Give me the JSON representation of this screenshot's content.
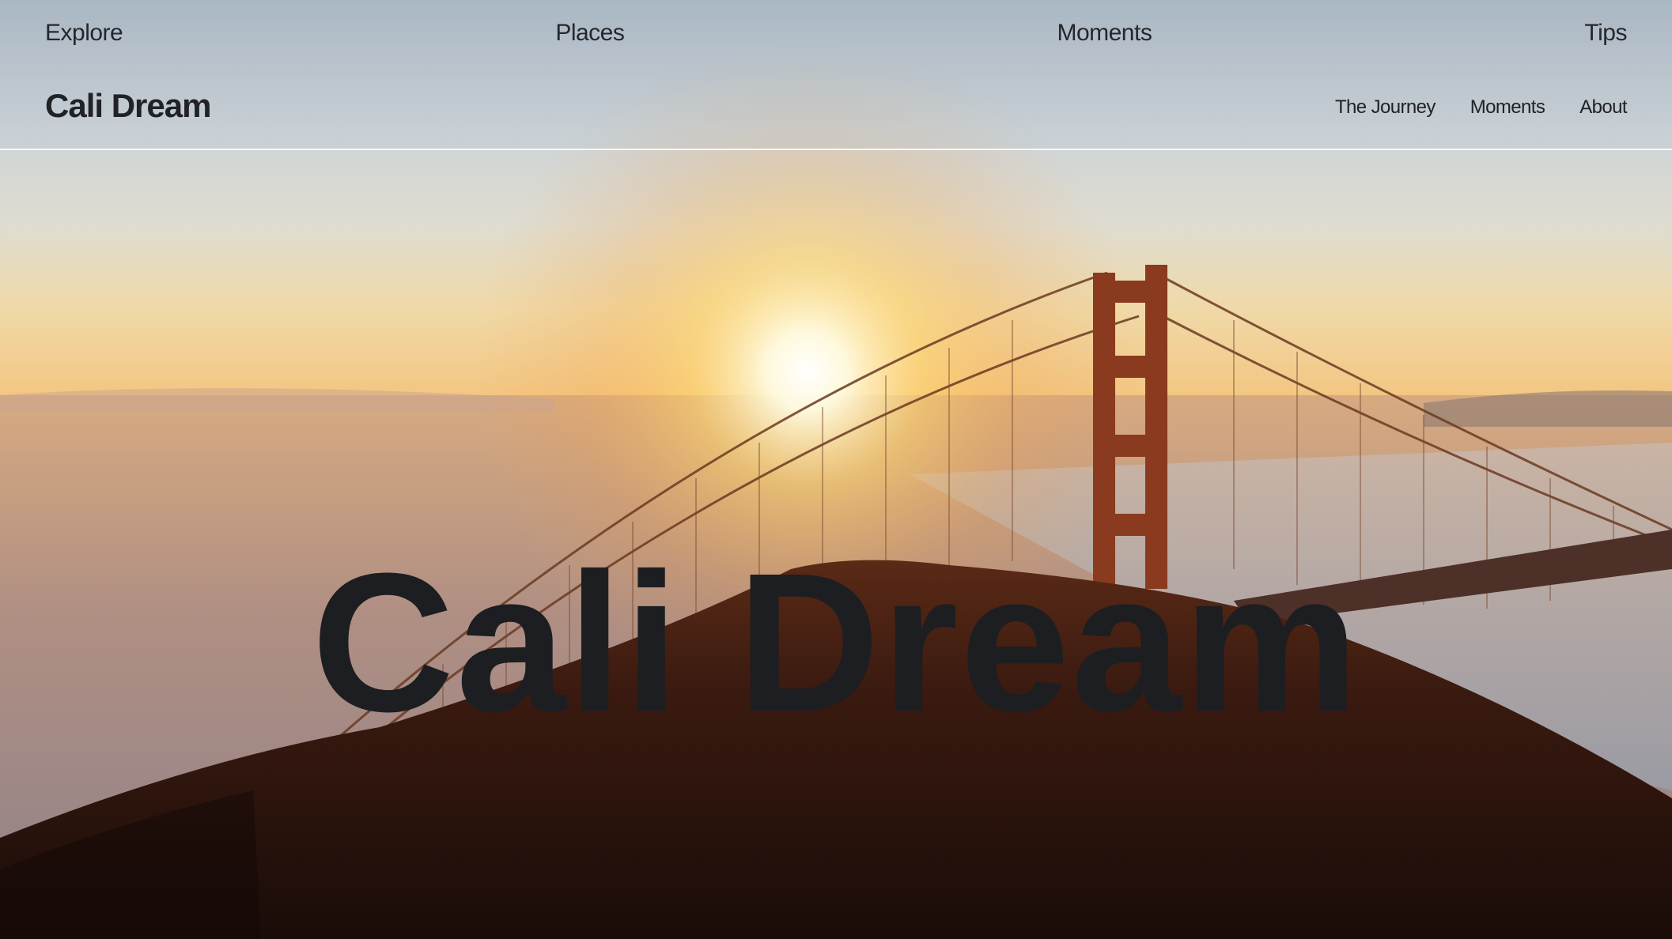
{
  "top_nav": {
    "items": [
      "Explore",
      "Places",
      "Moments",
      "Tips"
    ]
  },
  "header": {
    "brand": "Cali Dream",
    "nav": [
      "The Journey",
      "Moments",
      "About"
    ]
  },
  "hero": {
    "title": "Cali Dream",
    "background_image": "golden-gate-bridge-sunset-photo"
  }
}
